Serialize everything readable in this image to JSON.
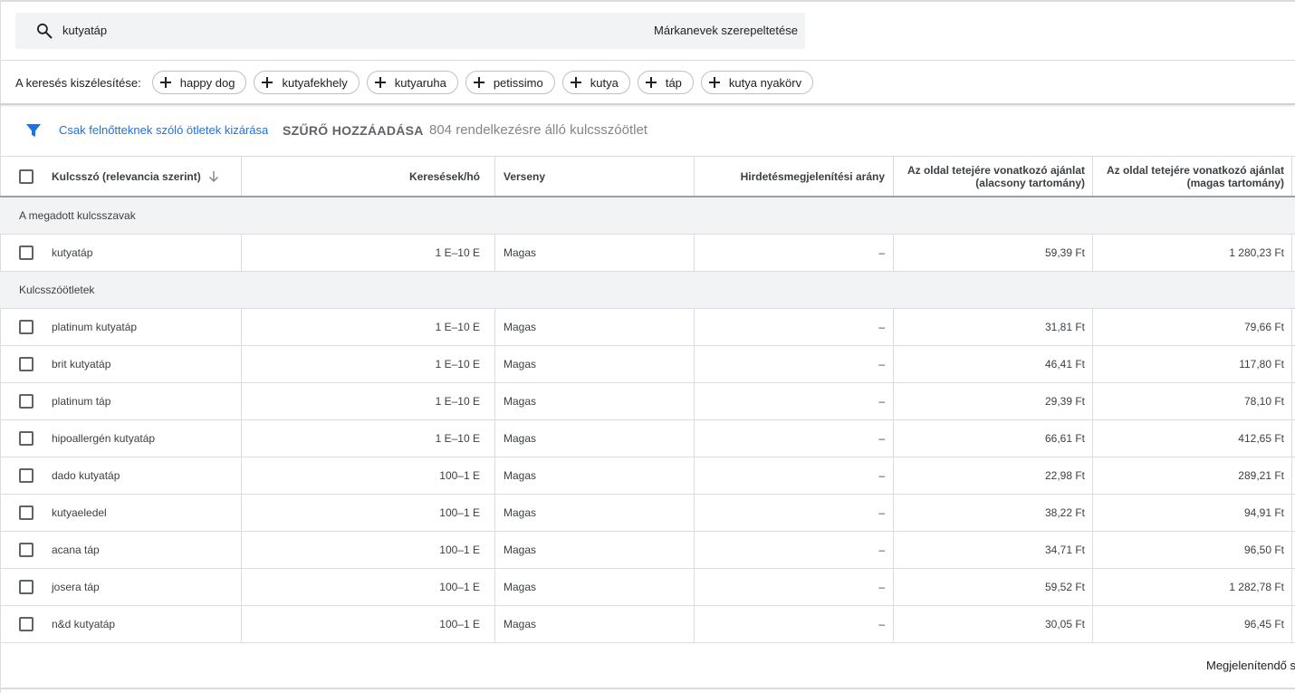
{
  "search": {
    "query": "kutyatáp",
    "brand_toggle": "Márkanevek szerepeltetése"
  },
  "broaden": {
    "label": "A keresés kiszélesítése:",
    "chips": [
      "happy dog",
      "kutyafekhely",
      "kutyaruha",
      "petissimo",
      "kutya",
      "táp",
      "kutya nyakörv"
    ]
  },
  "filter": {
    "exclude_adult": "Csak felnőtteknek szóló ötletek kizárása",
    "add_filter": "SZŰRŐ HOZZÁADÁSA",
    "ideas_count": "804 rendelkezésre álló kulcsszóötlet"
  },
  "table": {
    "headers": {
      "keyword": "Kulcsszó (relevancia szerint)",
      "searches": "Keresések/hó",
      "competition": "Verseny",
      "impression_share": "Hirdetésmegjelenítési arány",
      "bid_low_line1": "Az oldal tetejére vonatkozó ajánlat",
      "bid_low_line2": "(alacsony tartomány)",
      "bid_high_line1": "Az oldal tetejére vonatkozó ajánlat",
      "bid_high_line2": "(magas tartomány)"
    },
    "groups": [
      {
        "label": "A megadott kulcsszavak",
        "rows": [
          {
            "keyword": "kutyatáp",
            "searches": "1 E–10 E",
            "competition": "Magas",
            "impression": "–",
            "low": "59,39 Ft",
            "high": "1 280,23 Ft"
          }
        ]
      },
      {
        "label": "Kulcsszóötletek",
        "rows": [
          {
            "keyword": "platinum kutyatáp",
            "searches": "1 E–10 E",
            "competition": "Magas",
            "impression": "–",
            "low": "31,81 Ft",
            "high": "79,66 Ft"
          },
          {
            "keyword": "brit kutyatáp",
            "searches": "1 E–10 E",
            "competition": "Magas",
            "impression": "–",
            "low": "46,41 Ft",
            "high": "117,80 Ft"
          },
          {
            "keyword": "platinum táp",
            "searches": "1 E–10 E",
            "competition": "Magas",
            "impression": "–",
            "low": "29,39 Ft",
            "high": "78,10 Ft"
          },
          {
            "keyword": "hipoallergén kutyatáp",
            "searches": "1 E–10 E",
            "competition": "Magas",
            "impression": "–",
            "low": "66,61 Ft",
            "high": "412,65 Ft"
          },
          {
            "keyword": "dado kutyatáp",
            "searches": "100–1 E",
            "competition": "Magas",
            "impression": "–",
            "low": "22,98 Ft",
            "high": "289,21 Ft"
          },
          {
            "keyword": "kutyaeledel",
            "searches": "100–1 E",
            "competition": "Magas",
            "impression": "–",
            "low": "38,22 Ft",
            "high": "94,91 Ft"
          },
          {
            "keyword": "acana táp",
            "searches": "100–1 E",
            "competition": "Magas",
            "impression": "–",
            "low": "34,71 Ft",
            "high": "96,50 Ft"
          },
          {
            "keyword": "josera táp",
            "searches": "100–1 E",
            "competition": "Magas",
            "impression": "–",
            "low": "59,52 Ft",
            "high": "1 282,78 Ft"
          },
          {
            "keyword": "n&d kutyatáp",
            "searches": "100–1 E",
            "competition": "Magas",
            "impression": "–",
            "low": "30,05 Ft",
            "high": "96,45 Ft"
          }
        ]
      }
    ]
  },
  "footer": {
    "rows_per_page": "Megjelenítendő s"
  },
  "colors": {
    "link": "#1a73e8",
    "filter_icon": "#1a73e8",
    "group_bg": "#f1f3f4",
    "search_bg": "#f1f3f4"
  }
}
